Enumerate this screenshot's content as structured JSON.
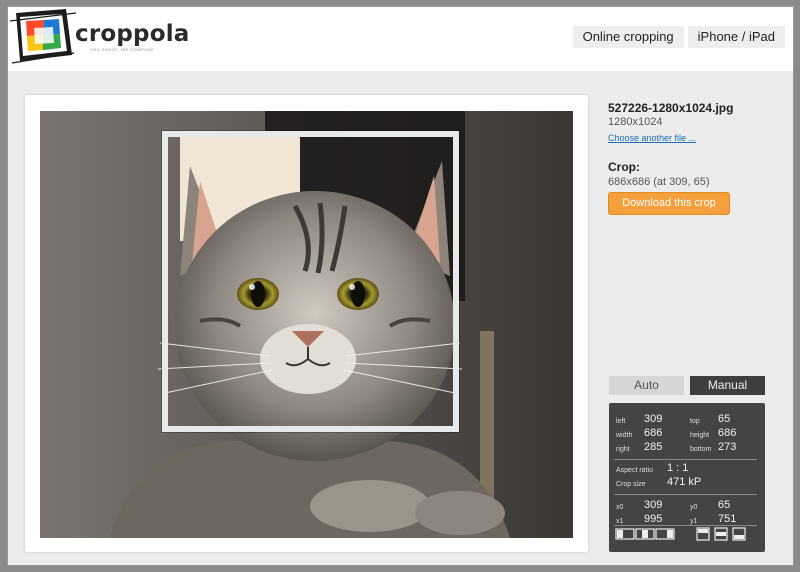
{
  "app": {
    "name": "croppola",
    "tagline": "YOU SHOOT, WE COMPOSE",
    "brand_colors": [
      "#ff4a2a",
      "#1e7ad4",
      "#f5c518",
      "#35a84a"
    ]
  },
  "nav": {
    "items": [
      {
        "label": "Online cropping"
      },
      {
        "label": "iPhone / iPad"
      }
    ]
  },
  "photo": {
    "subject": "tabby-cat-photo"
  },
  "file": {
    "name": "527226-1280x1024.jpg",
    "dimensions": "1280x1024",
    "choose_link": "Choose another file ..."
  },
  "crop": {
    "label": "Crop:",
    "info": "686x686 (at 309, 65)",
    "download_label": "Download this crop",
    "accent": "#f5a03c"
  },
  "mode": {
    "auto_label": "Auto",
    "manual_label": "Manual",
    "selected": "Manual"
  },
  "panel": {
    "left_label": "left",
    "left": "309",
    "top_label": "top",
    "top": "65",
    "width_label": "width",
    "width": "686",
    "height_label": "height",
    "height": "686",
    "right_label": "right",
    "right": "285",
    "bottom_label": "bottom",
    "bottom": "273",
    "aspect_label": "Aspect ratio",
    "aspect": "1 : 1",
    "size_label": "Crop size",
    "size": "471 kP",
    "x0_label": "x0",
    "x0": "309",
    "y0_label": "y0",
    "y0": "65",
    "x1_label": "x1",
    "x1": "995",
    "y1_label": "y1",
    "y1": "751"
  },
  "controls": {
    "horizontal": [
      "align-left-icon",
      "align-center-icon",
      "align-right-icon"
    ],
    "vertical": [
      "align-top-icon",
      "align-middle-icon",
      "align-bottom-icon"
    ]
  }
}
